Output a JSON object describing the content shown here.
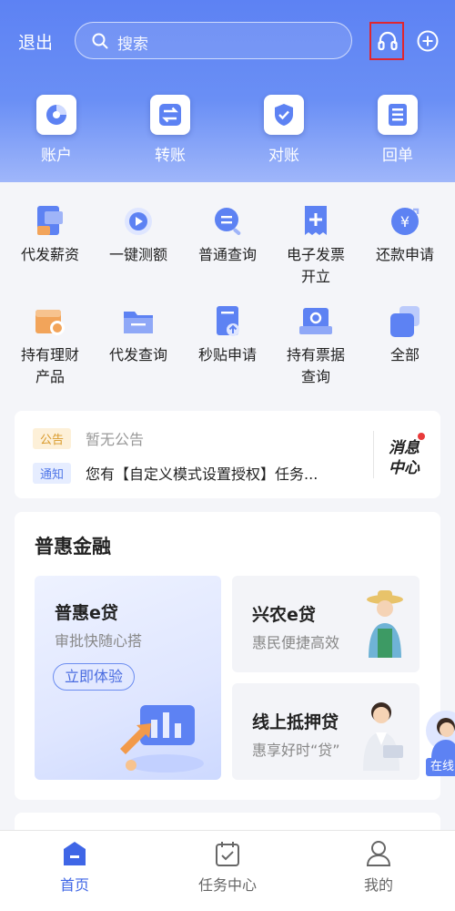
{
  "topbar": {
    "logout_label": "退出",
    "search_placeholder": "搜索",
    "icons": [
      "search-icon",
      "headset-icon",
      "plus-circle-icon"
    ]
  },
  "hero_items": [
    {
      "label": "账户",
      "icon": "account-pie-icon"
    },
    {
      "label": "转账",
      "icon": "transfer-arrows-icon"
    },
    {
      "label": "对账",
      "icon": "reconcile-shield-icon"
    },
    {
      "label": "回单",
      "icon": "receipt-icon"
    }
  ],
  "services": [
    {
      "label": "代发薪资",
      "icon": "payroll-icon"
    },
    {
      "label": "一键测额",
      "icon": "quota-test-icon"
    },
    {
      "label": "普通查询",
      "icon": "query-icon"
    },
    {
      "label": "电子发票开立",
      "line1": "电子发票",
      "line2": "开立",
      "icon": "e-invoice-icon"
    },
    {
      "label": "还款申请",
      "icon": "repayment-icon"
    },
    {
      "label": "持有理财产品",
      "line1": "持有理财",
      "line2": "产品",
      "icon": "wealth-product-icon"
    },
    {
      "label": "代发查询",
      "icon": "payroll-query-icon"
    },
    {
      "label": "秒贴申请",
      "icon": "discount-apply-icon"
    },
    {
      "label": "持有票据查询",
      "line1": "持有票据",
      "line2": "查询",
      "icon": "bill-query-icon"
    },
    {
      "label": "全部",
      "icon": "all-apps-icon"
    }
  ],
  "notice": {
    "announcement_tag": "公告",
    "announcement_text": "暂无公告",
    "notify_tag": "通知",
    "notify_text": "您有【自定义模式设置授权】任务...",
    "message_center_line1": "消息",
    "message_center_line2": "中心"
  },
  "finance": {
    "title": "普惠金融",
    "featured": {
      "title": "普惠e贷",
      "subtitle": "审批快随心搭",
      "button": "立即体验"
    },
    "cards": [
      {
        "title": "兴农e贷",
        "subtitle": "惠民便捷高效"
      },
      {
        "title": "线上抵押贷",
        "subtitle": "惠享好时“贷”"
      }
    ]
  },
  "online_service_label": "在线",
  "tabs": [
    {
      "label": "首页",
      "icon": "home-icon",
      "active": true
    },
    {
      "label": "任务中心",
      "icon": "task-calendar-icon",
      "active": false
    },
    {
      "label": "我的",
      "icon": "user-icon",
      "active": false
    }
  ],
  "colors": {
    "primary": "#5d82f3",
    "active_tab": "#3f66e6",
    "alert_red": "#e0262f"
  }
}
